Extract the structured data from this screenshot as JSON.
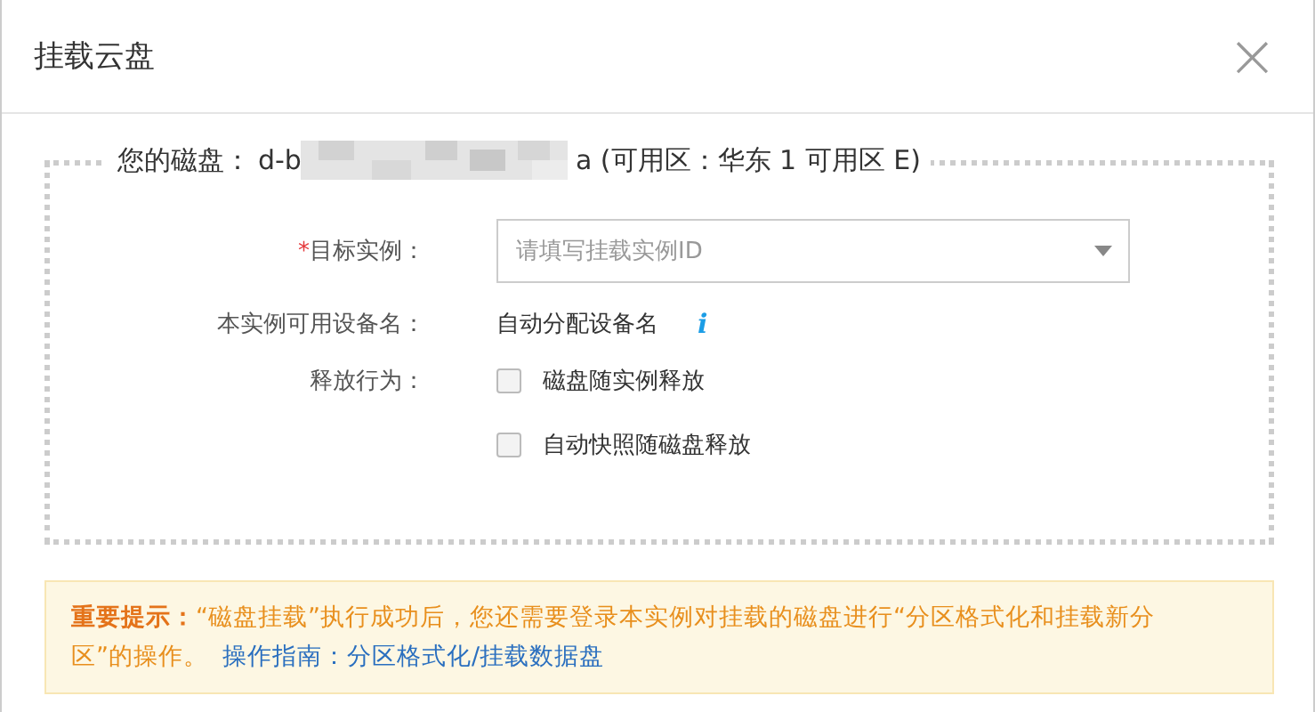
{
  "dialog": {
    "title": "挂载云盘",
    "close": "×"
  },
  "disk": {
    "label": "您的磁盘：",
    "id_prefix": "d-b",
    "id_suffix": "a (可用区：华东 1 可用区 E)"
  },
  "form": {
    "target": {
      "required_mark": "*",
      "label": "目标实例：",
      "placeholder": "请填写挂载实例ID"
    },
    "device": {
      "label": "本实例可用设备名：",
      "value": "自动分配设备名",
      "info": "i"
    },
    "release": {
      "label": "释放行为：",
      "options": [
        {
          "label": "磁盘随实例释放",
          "checked": false
        },
        {
          "label": "自动快照随磁盘释放",
          "checked": false
        }
      ]
    }
  },
  "notice": {
    "text": "**重要提示：**“磁盘挂载”执行成功后，您还需要登录本实例对挂载的磁盘进行“分区格式化和挂载新分区”的操作。",
    "link": "操作指南：分区格式化/挂载数据盘"
  }
}
